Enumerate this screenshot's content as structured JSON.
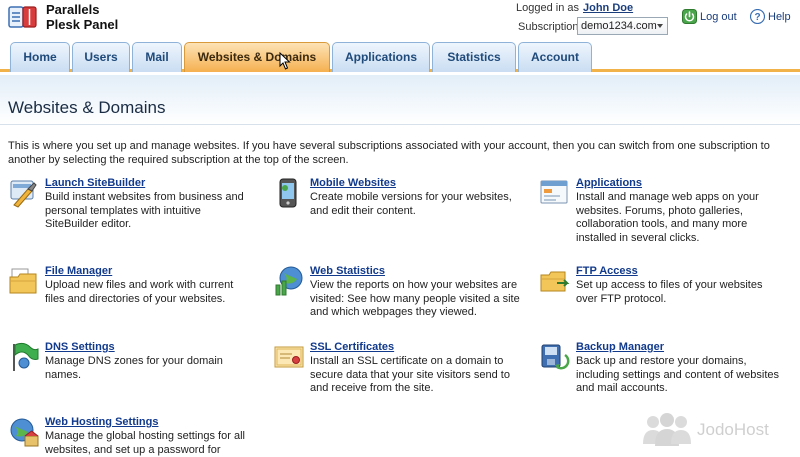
{
  "header": {
    "brand_line1": "Parallels",
    "brand_line2": "Plesk Panel",
    "logged_in_label": "Logged in as",
    "user_name": "John Doe",
    "subscription_label": "Subscription",
    "subscription_value": "demo1234.com",
    "logout_label": "Log out",
    "help_label": "Help"
  },
  "tabs": [
    {
      "label": "Home"
    },
    {
      "label": "Users"
    },
    {
      "label": "Mail"
    },
    {
      "label": "Websites & Domains"
    },
    {
      "label": "Applications"
    },
    {
      "label": "Statistics"
    },
    {
      "label": "Account"
    }
  ],
  "active_tab": "Websites & Domains",
  "page": {
    "title": "Websites & Domains",
    "intro": "This is where you set up and manage websites. If you have several subscriptions associated with your account, then you can switch from one subscription to another by selecting the required subscription at the top of the screen."
  },
  "tools": [
    {
      "name": "Launch SiteBuilder",
      "icon": "sitebuilder-icon",
      "desc": "Build instant websites from business and personal templates with intuitive SiteBuilder editor."
    },
    {
      "name": "Mobile Websites",
      "icon": "mobile-websites-icon",
      "desc": "Create mobile versions for your websites, and edit their content."
    },
    {
      "name": "Applications",
      "icon": "applications-icon",
      "desc": "Install and manage web apps on your websites. Forums, photo galleries, collaboration tools, and many more installed in several clicks."
    },
    {
      "name": "File Manager",
      "icon": "file-manager-icon",
      "desc": "Upload new files and work with current files and directories of your websites."
    },
    {
      "name": "Web Statistics",
      "icon": "web-statistics-icon",
      "desc": "View the reports on how your websites are visited: See how many people visited a site and which webpages they viewed."
    },
    {
      "name": "FTP Access",
      "icon": "ftp-access-icon",
      "desc": "Set up access to files of your websites over FTP protocol."
    },
    {
      "name": "DNS Settings",
      "icon": "dns-settings-icon",
      "desc": "Manage DNS zones for your domain names."
    },
    {
      "name": "SSL Certificates",
      "icon": "ssl-certificates-icon",
      "desc": "Install an SSL certificate on a domain to secure data that your site visitors send to and receive from the site."
    },
    {
      "name": "Backup Manager",
      "icon": "backup-manager-icon",
      "desc": "Back up and restore your domains, including settings and content of websites and mail accounts."
    },
    {
      "name": "Web Hosting Settings",
      "icon": "web-hosting-settings-icon",
      "desc": "Manage the global hosting settings for all websites, and set up a password for access"
    }
  ],
  "watermark": "JodoHost",
  "colors": {
    "tab_active": "#f5b050",
    "tab_inactive": "#c9ddf2",
    "link": "#123a8c",
    "accent_line": "#f2b24a"
  }
}
